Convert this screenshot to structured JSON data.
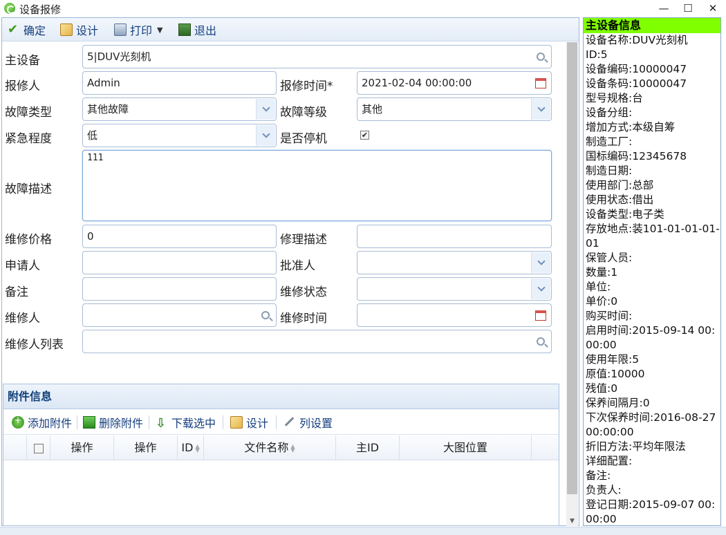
{
  "window": {
    "title": "设备报修",
    "minimize": "—",
    "maximize": "☐",
    "close": "✕"
  },
  "toolbar": {
    "confirm": "确定",
    "design": "设计",
    "print": "打印",
    "exit": "退出"
  },
  "form": {
    "main_device": {
      "label": "主设备",
      "value": "5|DUV光刻机"
    },
    "reporter": {
      "label": "报修人",
      "value": "Admin"
    },
    "report_time": {
      "label": "报修时间*",
      "value": "2021-02-04 00:00:00"
    },
    "fault_type": {
      "label": "故障类型",
      "value": "其他故障"
    },
    "fault_level": {
      "label": "故障等级",
      "value": "其他"
    },
    "urgency": {
      "label": "紧急程度",
      "value": "低"
    },
    "stopped": {
      "label": "是否停机",
      "checked": "✔"
    },
    "fault_desc": {
      "label": "故障描述",
      "value": "111"
    },
    "repair_price": {
      "label": "维修价格",
      "value": "0"
    },
    "repair_desc": {
      "label": "修理描述",
      "value": ""
    },
    "applicant": {
      "label": "申请人",
      "value": ""
    },
    "approver": {
      "label": "批准人",
      "value": ""
    },
    "remark": {
      "label": "备注",
      "value": ""
    },
    "repair_status": {
      "label": "维修状态",
      "value": ""
    },
    "repairer": {
      "label": "维修人",
      "value": ""
    },
    "repair_time": {
      "label": "维修时间",
      "value": ""
    },
    "repairer_list": {
      "label": "维修人列表",
      "value": ""
    }
  },
  "attachments": {
    "title": "附件信息",
    "tools": {
      "add": "添加附件",
      "remove": "删除附件",
      "download": "下载选中",
      "design": "设计",
      "columns": "列设置"
    },
    "columns": [
      "操作",
      "操作",
      "ID",
      "文件名称",
      "主ID",
      "大图位置"
    ]
  },
  "device_info": {
    "title": "主设备信息",
    "lines": [
      "设备名称:DUV光刻机",
      "ID:5",
      "设备编码:10000047",
      "设备条码:10000047",
      "型号规格:台",
      "设备分组:",
      "增加方式:本级自筹",
      "制造工厂:",
      "国标编码:12345678",
      "制造日期:",
      "使用部门:总部",
      "使用状态:借出",
      "设备类型:电子类",
      "存放地点:装101-01-01-01-01",
      "保管人员:",
      "数量:1",
      "单位:",
      "单价:0",
      "购买时间:",
      "启用时间:2015-09-14 00:00:00",
      "使用年限:5",
      "原值:10000",
      "残值:0",
      "保养间隔月:0",
      "下次保养时间:2016-08-27 00:00:00",
      "折旧方法:平均年限法",
      "详细配置:",
      "备注:",
      "负责人:",
      "登记日期:2015-09-07 00:00:00"
    ]
  }
}
